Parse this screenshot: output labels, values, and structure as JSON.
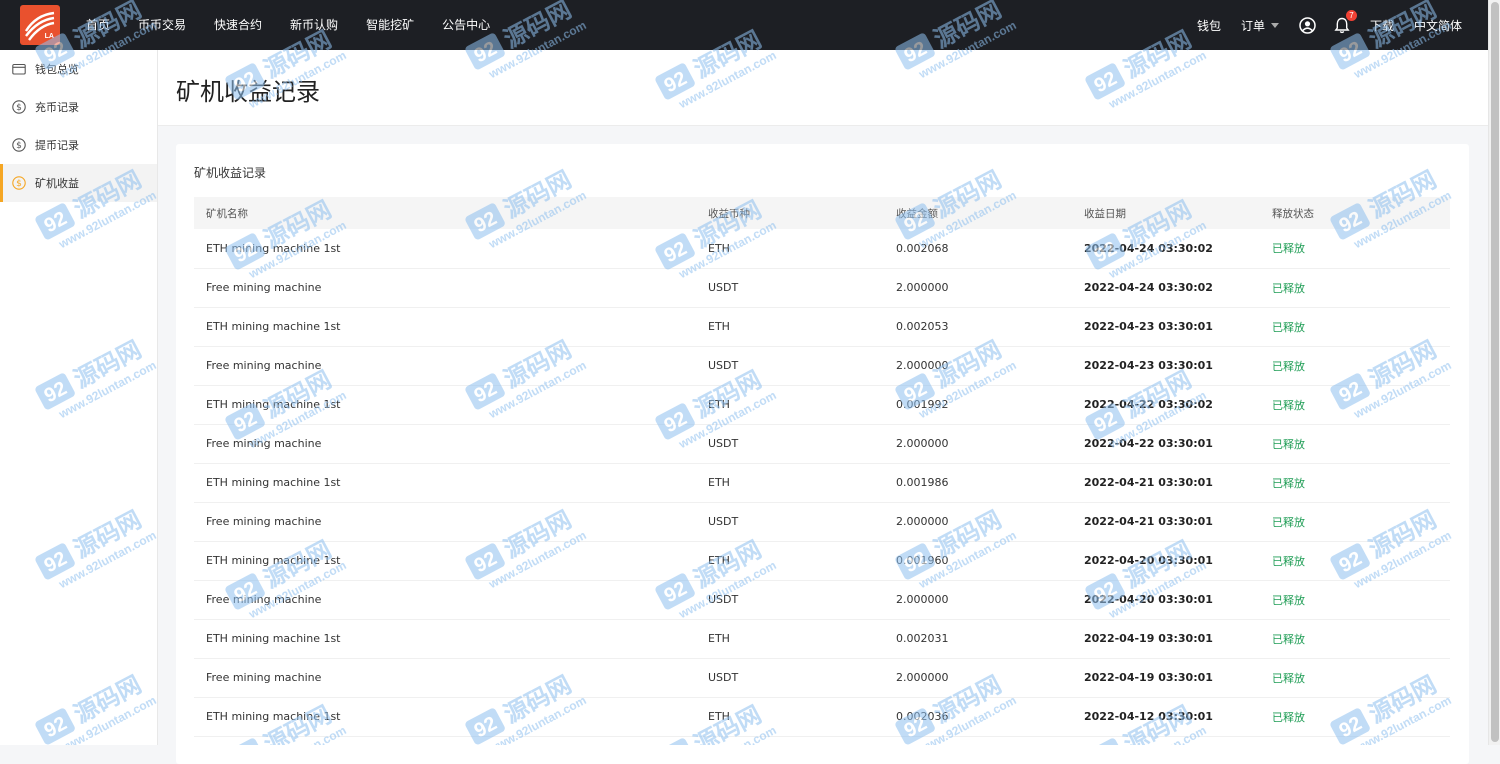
{
  "header": {
    "logo_text": "LA",
    "nav": [
      "首页",
      "币币交易",
      "快速合约",
      "新币认购",
      "智能挖矿",
      "公告中心"
    ],
    "wallet": "钱包",
    "orders": "订单",
    "notification_count": "7",
    "download": "下载",
    "language": "中文简体"
  },
  "sidebar": {
    "items": [
      {
        "label": "钱包总览",
        "icon": "wallet-icon"
      },
      {
        "label": "充币记录",
        "icon": "dollar-circle-icon"
      },
      {
        "label": "提币记录",
        "icon": "dollar-circle-icon"
      },
      {
        "label": "矿机收益",
        "icon": "dollar-circle-icon",
        "active": true
      }
    ]
  },
  "page": {
    "title": "矿机收益记录",
    "card_title": "矿机收益记录"
  },
  "table": {
    "columns": [
      "矿机名称",
      "收益币种",
      "收益金额",
      "收益日期",
      "释放状态"
    ],
    "rows": [
      [
        "ETH mining machine 1st",
        "ETH",
        "0.002068",
        "2022-04-24 03:30:02",
        "已释放"
      ],
      [
        "Free mining machine",
        "USDT",
        "2.000000",
        "2022-04-24 03:30:02",
        "已释放"
      ],
      [
        "ETH mining machine 1st",
        "ETH",
        "0.002053",
        "2022-04-23 03:30:01",
        "已释放"
      ],
      [
        "Free mining machine",
        "USDT",
        "2.000000",
        "2022-04-23 03:30:01",
        "已释放"
      ],
      [
        "ETH mining machine 1st",
        "ETH",
        "0.001992",
        "2022-04-22 03:30:02",
        "已释放"
      ],
      [
        "Free mining machine",
        "USDT",
        "2.000000",
        "2022-04-22 03:30:01",
        "已释放"
      ],
      [
        "ETH mining machine 1st",
        "ETH",
        "0.001986",
        "2022-04-21 03:30:01",
        "已释放"
      ],
      [
        "Free mining machine",
        "USDT",
        "2.000000",
        "2022-04-21 03:30:01",
        "已释放"
      ],
      [
        "ETH mining machine 1st",
        "ETH",
        "0.001960",
        "2022-04-20 03:30:01",
        "已释放"
      ],
      [
        "Free mining machine",
        "USDT",
        "2.000000",
        "2022-04-20 03:30:01",
        "已释放"
      ],
      [
        "ETH mining machine 1st",
        "ETH",
        "0.002031",
        "2022-04-19 03:30:01",
        "已释放"
      ],
      [
        "Free mining machine",
        "USDT",
        "2.000000",
        "2022-04-19 03:30:01",
        "已释放"
      ],
      [
        "ETH mining machine 1st",
        "ETH",
        "0.002036",
        "2022-04-12 03:30:01",
        "已释放"
      ]
    ]
  },
  "watermark": {
    "brand": "92",
    "cn_text": "源码网",
    "url": "www.92luntan.com"
  },
  "colors": {
    "topbar": "#1d1f24",
    "logo": "#e9512e",
    "active_accent": "#f5a623",
    "status_green": "#1f9d55",
    "badge_red": "#f04134"
  }
}
